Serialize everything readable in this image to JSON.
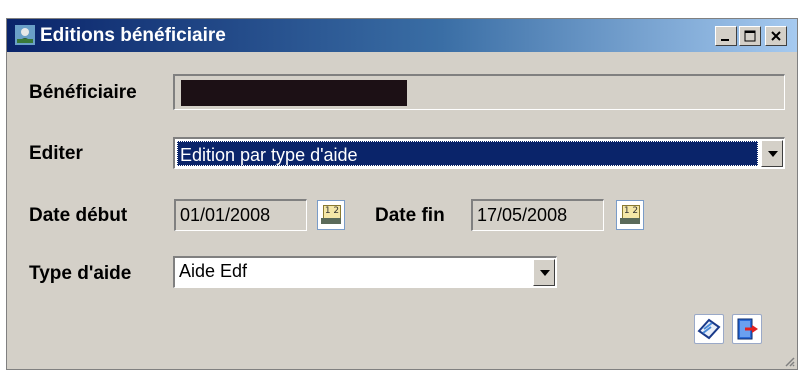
{
  "window": {
    "title": "Editions bénéficiaire",
    "controls": {
      "minimize": "_",
      "maximize": "□",
      "close": "×"
    }
  },
  "form": {
    "beneficiaire": {
      "label": "Bénéficiaire",
      "value": ""
    },
    "editer": {
      "label": "Editer",
      "value": "Edition par type d'aide"
    },
    "date_debut": {
      "label": "Date début",
      "value": "01/01/2008"
    },
    "date_fin": {
      "label": "Date fin",
      "value": "17/05/2008"
    },
    "type_aide": {
      "label": "Type d'aide",
      "value": "Aide Edf"
    },
    "calendar_icon_text": "1 2"
  },
  "actions": {
    "print": {
      "icon": "eraser-print-icon"
    },
    "exit": {
      "icon": "exit-door-icon"
    }
  },
  "colors": {
    "titlebar_start": "#0a246a",
    "titlebar_end": "#a6caf0",
    "selection": "#0a246a",
    "window_bg": "#d4d0c8"
  }
}
